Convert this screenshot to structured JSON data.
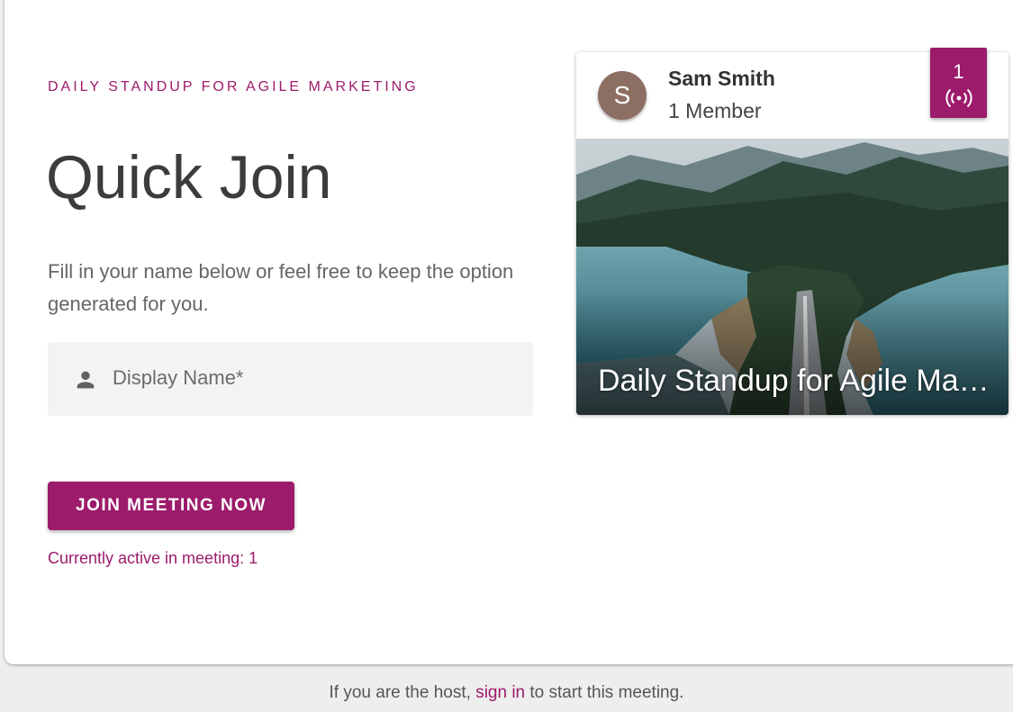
{
  "meeting": {
    "overline": "DAILY STANDUP FOR AGILE MARKETING",
    "title": "Quick Join",
    "description": "Fill in your name below or feel free to keep the option generated for you."
  },
  "form": {
    "display_name_placeholder": "Display Name*",
    "display_name_value": "",
    "person_icon": "person-icon",
    "join_button_label": "JOIN MEETING NOW",
    "active_label": "Currently active in meeting: 1"
  },
  "card": {
    "avatar_initial": "S",
    "host_name": "Sam Smith",
    "member_count": "1 Member",
    "live_count": "1",
    "live_icon": "broadcast-icon",
    "image_title": "Daily Standup for Agile Marketing",
    "image_subject": "aerial view of a lake road between forested mountains"
  },
  "footer": {
    "text_before": "If you are the host, ",
    "link_label": "sign in",
    "text_after": " to start this meeting."
  },
  "colors": {
    "accent": "#9c1b6b",
    "avatar": "#8d6e63",
    "page_background": "#eeeeee"
  }
}
